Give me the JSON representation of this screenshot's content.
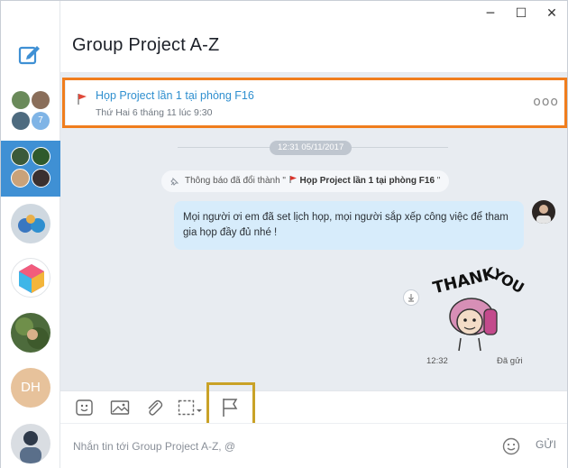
{
  "window": {
    "minimize_glyph": "─",
    "maximize_glyph": "☐",
    "close_glyph": "✕"
  },
  "sidebar": {
    "compose_icon": "compose-icon",
    "group_unread_badge": "7",
    "contact_initials": "DH",
    "accent": "#3f90d4"
  },
  "header": {
    "title": "Group Project A-Z"
  },
  "pinned": {
    "title": "Họp Project lần 1 tại phòng F16",
    "subtitle": "Thứ Hai 6 tháng 11 lúc 9:30",
    "more": "ooo",
    "outline_color": "#f07d1d"
  },
  "chat": {
    "date_pill": "12:31 05/11/2017",
    "sys_prefix": "Thông báo đã đổi thành \"",
    "sys_name": "Họp Project lần 1 tại phòng F16",
    "sys_suffix": "\"",
    "message": "Mọi người ơi em đã set lịch họp, mọi người sắp xếp công việc để tham gia họp đầy đủ nhé !",
    "sticker_text": "THANK YOU",
    "time": "12:32",
    "status": "Đã gửi"
  },
  "toolbar": {
    "tools": [
      "sticker-icon",
      "image-icon",
      "attachment-icon",
      "screenshot-icon",
      "flag-icon"
    ],
    "highlight_color": "#c9a227"
  },
  "composer": {
    "placeholder": "Nhắn tin tới Group Project A-Z, @",
    "send_label": "GỬI"
  }
}
